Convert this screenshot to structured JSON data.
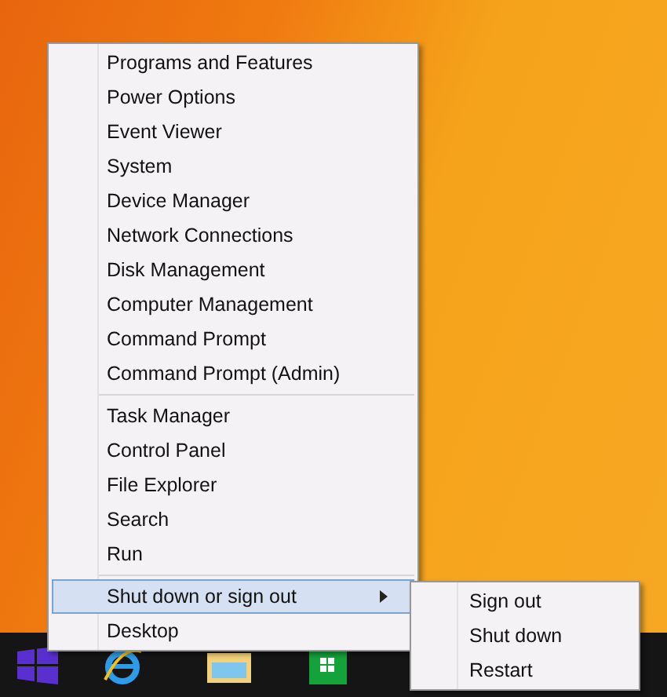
{
  "menu": {
    "groups": [
      {
        "items": [
          {
            "label": "Programs and Features",
            "selected": false
          },
          {
            "label": "Power Options",
            "selected": false
          },
          {
            "label": "Event Viewer",
            "selected": false
          },
          {
            "label": "System",
            "selected": false
          },
          {
            "label": "Device Manager",
            "selected": false
          },
          {
            "label": "Network Connections",
            "selected": false
          },
          {
            "label": "Disk Management",
            "selected": false
          },
          {
            "label": "Computer Management",
            "selected": false
          },
          {
            "label": "Command Prompt",
            "selected": false
          },
          {
            "label": "Command Prompt (Admin)",
            "selected": false
          }
        ]
      },
      {
        "items": [
          {
            "label": "Task Manager",
            "selected": false
          },
          {
            "label": "Control Panel",
            "selected": false
          },
          {
            "label": "File Explorer",
            "selected": false
          },
          {
            "label": "Search",
            "selected": false
          },
          {
            "label": "Run",
            "selected": false
          }
        ]
      },
      {
        "items": [
          {
            "label": "Shut down or sign out",
            "selected": true,
            "submenu": true
          },
          {
            "label": "Desktop",
            "selected": false
          }
        ]
      }
    ]
  },
  "submenu": {
    "items": [
      {
        "label": "Sign out",
        "selected": false
      },
      {
        "label": "Shut down",
        "selected": false
      },
      {
        "label": "Restart",
        "selected": false
      }
    ]
  }
}
